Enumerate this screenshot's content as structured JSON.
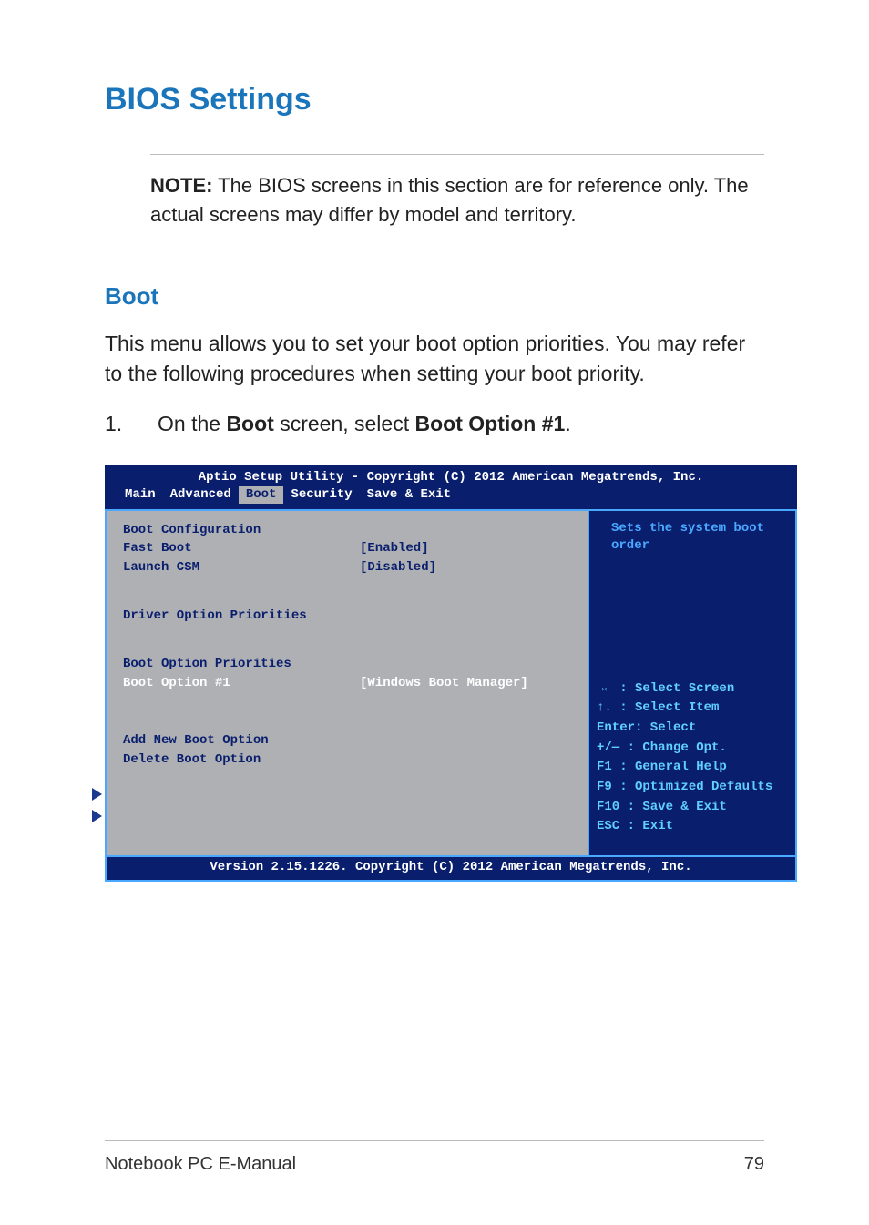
{
  "title": "BIOS Settings",
  "note": {
    "label": "NOTE:",
    "text": " The BIOS screens in this section are for reference only. The actual screens may differ by model and territory."
  },
  "subhead": "Boot",
  "intro": "This menu allows you to set your boot option priorities. You may refer to the following procedures when setting your boot priority.",
  "step1": {
    "num": "1.",
    "pre": "On the ",
    "b1": "Boot",
    "mid": " screen, select ",
    "b2": "Boot Option #1",
    "post": "."
  },
  "bios": {
    "header": "Aptio Setup Utility - Copyright (C) 2012 American Megatrends, Inc.",
    "tabs": {
      "main": "Main",
      "advanced": "Advanced",
      "boot": "Boot",
      "security": "Security",
      "save": "Save & Exit"
    },
    "left": {
      "section_cfg": "Boot Configuration",
      "fast_boot_lbl": "Fast Boot",
      "fast_boot_val": "[Enabled]",
      "launch_csm_lbl": "Launch CSM",
      "launch_csm_val": "[Disabled]",
      "driver_prio": "Driver Option Priorities",
      "boot_prio": "Boot Option Priorities",
      "boot_opt1_lbl": "Boot Option #1",
      "boot_opt1_val": "[Windows Boot Manager]",
      "add_new": "Add New Boot Option",
      "delete": "Delete Boot Option"
    },
    "right": {
      "help": "Sets the system boot order",
      "legend": {
        "l1": "→←  : Select Screen",
        "l2": "↑↓  : Select Item",
        "l3": "Enter: Select",
        "l4": "+/—  : Change Opt.",
        "l5": "F1   : General Help",
        "l6": "F9   : Optimized Defaults",
        "l7": "F10  : Save & Exit",
        "l8": "ESC  : Exit"
      }
    },
    "footer": "Version 2.15.1226. Copyright (C) 2012 American Megatrends, Inc."
  },
  "page_footer": {
    "left": "Notebook PC E-Manual",
    "right": "79"
  }
}
